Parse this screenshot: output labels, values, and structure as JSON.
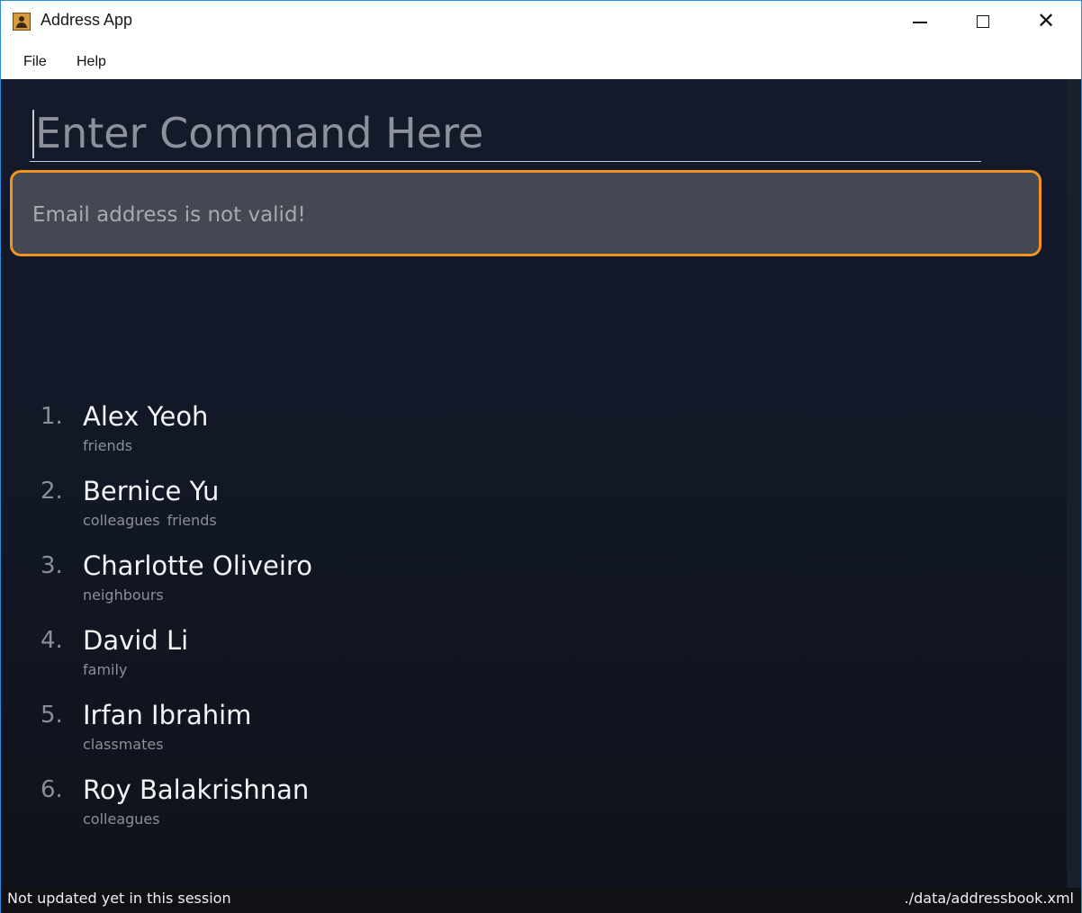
{
  "window": {
    "title": "Address App"
  },
  "menu": {
    "file": "File",
    "help": "Help"
  },
  "command": {
    "placeholder": "Enter Command Here",
    "value": ""
  },
  "result": {
    "message": "Email address is not valid!",
    "border_color": "#f0951e"
  },
  "persons": [
    {
      "index": "1.",
      "name": "Alex Yeoh",
      "tags": [
        "friends"
      ]
    },
    {
      "index": "2.",
      "name": "Bernice Yu",
      "tags": [
        "colleagues",
        "friends"
      ]
    },
    {
      "index": "3.",
      "name": "Charlotte Oliveiro",
      "tags": [
        "neighbours"
      ]
    },
    {
      "index": "4.",
      "name": "David Li",
      "tags": [
        "family"
      ]
    },
    {
      "index": "5.",
      "name": "Irfan Ibrahim",
      "tags": [
        "classmates"
      ]
    },
    {
      "index": "6.",
      "name": "Roy Balakrishnan",
      "tags": [
        "colleagues"
      ]
    }
  ],
  "status": {
    "sync": "Not updated yet in this session",
    "file_path": "./data/addressbook.xml"
  }
}
